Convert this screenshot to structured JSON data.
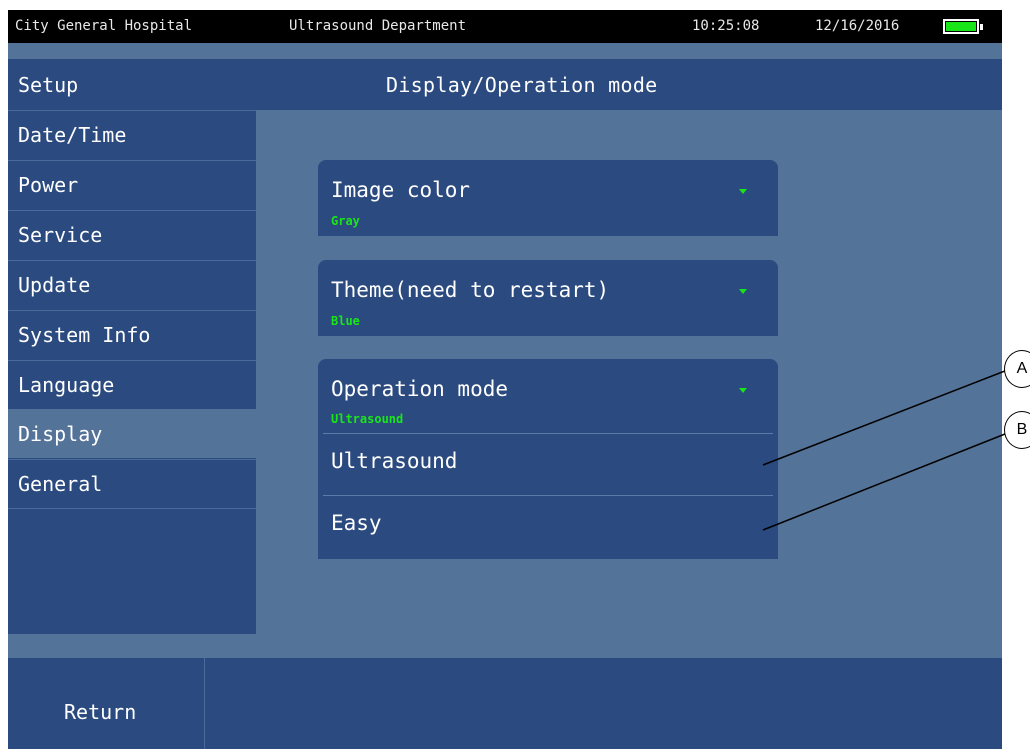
{
  "status_bar": {
    "hospital": "City General Hospital",
    "department": "Ultrasound Department",
    "time": "10:25:08",
    "date": "12/16/2016",
    "battery_icon": "battery-full-icon",
    "battery_color": "#19e619"
  },
  "header": {
    "section": "Setup",
    "title": "Display/Operation mode"
  },
  "sidebar": {
    "items": [
      {
        "label": "Date/Time"
      },
      {
        "label": "Power"
      },
      {
        "label": "Service"
      },
      {
        "label": "Update"
      },
      {
        "label": "System Info"
      },
      {
        "label": "Language"
      },
      {
        "label": "Display",
        "active": true
      },
      {
        "label": "General"
      }
    ]
  },
  "settings": {
    "image_color": {
      "label": "Image color",
      "value": "Gray"
    },
    "theme": {
      "label": "Theme(need to restart)",
      "value": "Blue"
    },
    "operation_mode": {
      "label": "Operation mode",
      "value": "Ultrasound",
      "options": [
        "Ultrasound",
        "Easy"
      ]
    }
  },
  "footer": {
    "return_label": "Return"
  },
  "callouts": {
    "a": "A",
    "b": "B"
  },
  "colors": {
    "background": "#547399",
    "panel": "#2b4a7f",
    "accent": "#19e619"
  }
}
